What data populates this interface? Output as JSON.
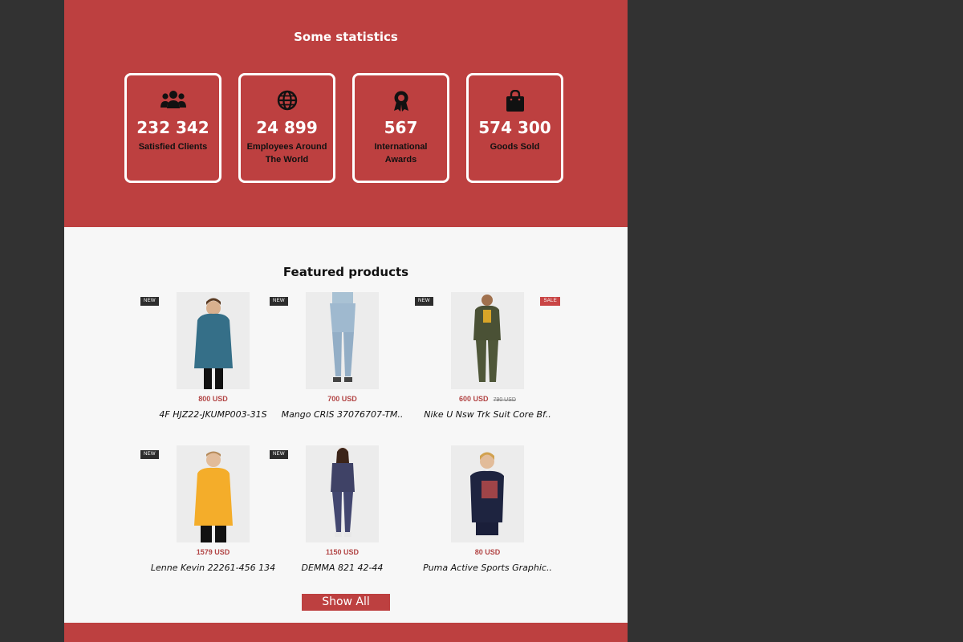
{
  "statistics": {
    "title": "Some statistics",
    "items": [
      {
        "icon": "users-icon",
        "value": "232 342",
        "label": "Satisfied Clients"
      },
      {
        "icon": "globe-icon",
        "value": "24 899",
        "label": "Employees Around The World"
      },
      {
        "icon": "award-icon",
        "value": "567",
        "label": "International Awards"
      },
      {
        "icon": "shopping-bag-icon",
        "value": "574 300",
        "label": "Goods Sold"
      }
    ]
  },
  "featured": {
    "title": "Featured products",
    "products": [
      {
        "badge": "NEW",
        "sale_badge": "",
        "price": "800 USD",
        "old_price": "",
        "name": "4F HJZ22-JKUMP003-31S"
      },
      {
        "badge": "NEW",
        "sale_badge": "",
        "price": "700 USD",
        "old_price": "",
        "name": "Mango CRIS 37076707-TM.."
      },
      {
        "badge": "NEW",
        "sale_badge": "SALE",
        "price": "600 USD",
        "old_price": "790 USD",
        "name": "Nike U Nsw Trk Suit Core Bf.."
      },
      {
        "badge": "NEW",
        "sale_badge": "",
        "price": "1579 USD",
        "old_price": "",
        "name": "Lenne Kevin 22261-456 134"
      },
      {
        "badge": "NEW",
        "sale_badge": "",
        "price": "1150 USD",
        "old_price": "",
        "name": "DEMMA 821 42-44"
      },
      {
        "badge": "",
        "sale_badge": "",
        "price": "80 USD",
        "old_price": "",
        "name": "Puma Active Sports Graphic.."
      }
    ],
    "show_all_label": "Show All"
  },
  "colors": {
    "brand_red": "#bd4040",
    "page_bg": "#f7f7f7",
    "outer_bg": "#323232"
  }
}
